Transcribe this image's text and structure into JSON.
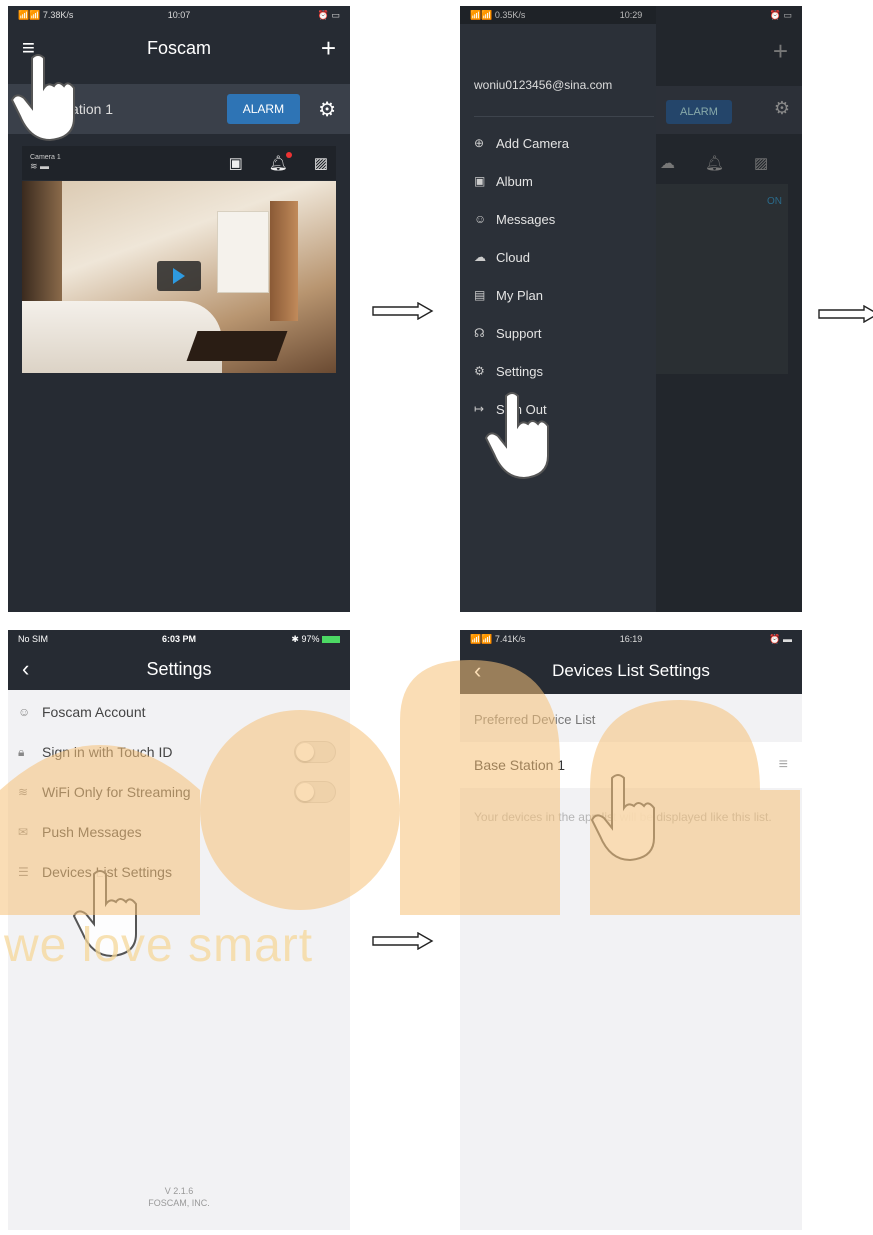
{
  "p1": {
    "status_left": "📶📶 7.38K/s",
    "status_time": "10:07",
    "title": "Foscam",
    "station_name": "Base Station 1",
    "alarm_label": "ALARM",
    "camera_label": "Camera 1"
  },
  "p2": {
    "status_left": "📶📶 0.35K/s",
    "status_time": "10:29",
    "email": "woniu0123456@sina.com",
    "menu": [
      {
        "label": "Add Camera",
        "icon": "plus-circle-icon"
      },
      {
        "label": "Album",
        "icon": "image-icon"
      },
      {
        "label": "Messages",
        "icon": "chat-icon"
      },
      {
        "label": "Cloud",
        "icon": "cloud-icon"
      },
      {
        "label": "My Plan",
        "icon": "plan-icon"
      },
      {
        "label": "Support",
        "icon": "headset-icon"
      },
      {
        "label": "Settings",
        "icon": "gear-icon"
      },
      {
        "label": "Sign Out",
        "icon": "sign-out-icon"
      }
    ],
    "alarm_label": "ALARM",
    "on_label": "ON"
  },
  "p3": {
    "status_left": "No SIM",
    "status_time": "6:03 PM",
    "status_battery": "97%",
    "title": "Settings",
    "items": [
      {
        "label": "Foscam Account",
        "icon": "account-icon"
      },
      {
        "label": "Sign in with Touch ID",
        "icon": "lock-icon"
      },
      {
        "label": "WiFi Only for Streaming",
        "icon": "wifi-icon"
      },
      {
        "label": "Push Messages",
        "icon": "message-icon"
      },
      {
        "label": "Devices List Settings",
        "icon": "list-icon"
      }
    ],
    "version": "V 2.1.6",
    "company": "FOSCAM, INC."
  },
  "p4": {
    "status_left": "📶📶 7.41K/s",
    "status_time": "16:19",
    "title": "Devices List Settings",
    "section": "Preferred Device List",
    "device": "Base Station 1",
    "hint": "Your devices in the app list will be displayed like this list."
  },
  "watermark": {
    "text": "we love smart",
    "color": "#f6d89a"
  },
  "colors": {
    "dark_bg": "#262b33",
    "accent_blue": "#2f6fae",
    "alarm_bg": "#2e74b5"
  }
}
